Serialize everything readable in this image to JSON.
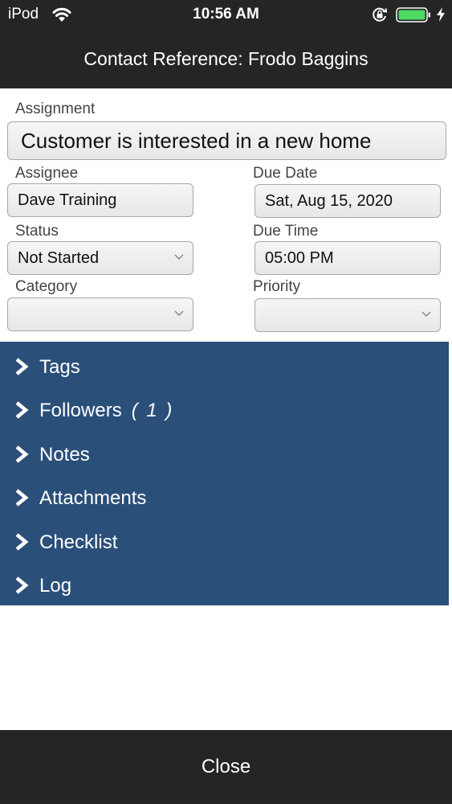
{
  "status_bar": {
    "carrier": "iPod",
    "time": "10:56 AM",
    "wifi_icon": "wifi-icon",
    "lock_icon": "orientation-lock-icon",
    "battery_icon": "battery-icon",
    "charging_icon": "bolt-icon",
    "battery_color": "#4cd964"
  },
  "header": {
    "title": "Contact Reference: Frodo Baggins"
  },
  "form": {
    "assignment": {
      "label": "Assignment",
      "value": "Customer is interested in a new home"
    },
    "assignee": {
      "label": "Assignee",
      "value": "Dave Training"
    },
    "due_date": {
      "label": "Due Date",
      "value": "Sat, Aug 15, 2020"
    },
    "status": {
      "label": "Status",
      "value": "Not Started"
    },
    "due_time": {
      "label": "Due Time",
      "value": "05:00 PM"
    },
    "category": {
      "label": "Category",
      "value": ""
    },
    "priority": {
      "label": "Priority",
      "value": ""
    }
  },
  "sections": [
    {
      "label": "Tags",
      "count": ""
    },
    {
      "label": "Followers",
      "count": "( 1 )"
    },
    {
      "label": "Notes",
      "count": ""
    },
    {
      "label": "Attachments",
      "count": ""
    },
    {
      "label": "Checklist",
      "count": ""
    },
    {
      "label": "Log",
      "count": ""
    }
  ],
  "colors": {
    "header_bg": "#252525",
    "section_bg": "#2a4f79"
  },
  "footer": {
    "close_label": "Close"
  }
}
